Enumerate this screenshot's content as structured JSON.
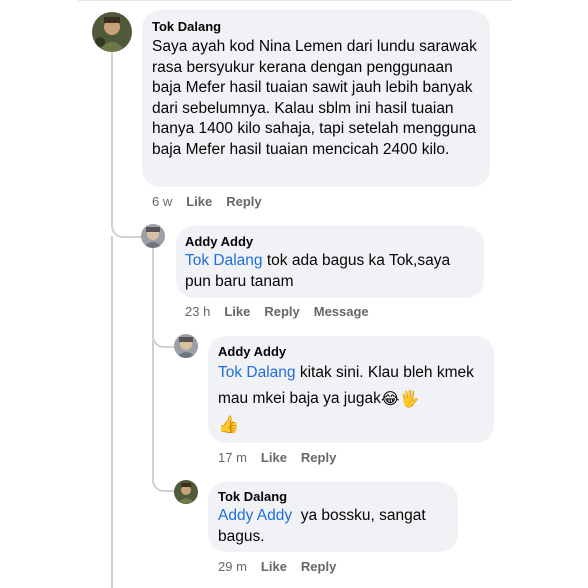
{
  "comments": [
    {
      "name": "Tok Dalang",
      "mention": "",
      "text": "Saya ayah kod Nina Lemen dari lundu sarawak rasa bersyukur kerana dengan penggunaan baja Mefer hasil tuaian sawit jauh lebih banyak dari sebelumnya. Kalau sblm ini hasil tuaian hanya 1400 kilo sahaja, tapi setelah mengguna baja Mefer hasil tuaian mencicah 2400 kilo.",
      "time": "6 w",
      "actions": [
        "Like",
        "Reply"
      ]
    },
    {
      "name": "Addy Addy",
      "mention": "Tok Dalang",
      "text": " tok ada bagus ka Tok,saya pun baru tanam",
      "time": "23 h",
      "actions": [
        "Like",
        "Reply",
        "Message"
      ]
    },
    {
      "name": "Addy Addy",
      "mention": "Tok Dalang",
      "text": " kitak sini. Klau bleh kmek mau mkei baja ya jugak",
      "emoji": "😂🖐",
      "emoji2": "👍",
      "time": "17 m",
      "actions": [
        "Like",
        "Reply"
      ]
    },
    {
      "name": "Tok Dalang",
      "mention": "Addy Addy",
      "text": "  ya bossku, sangat bagus.",
      "time": "29 m",
      "actions": [
        "Like",
        "Reply"
      ]
    }
  ]
}
